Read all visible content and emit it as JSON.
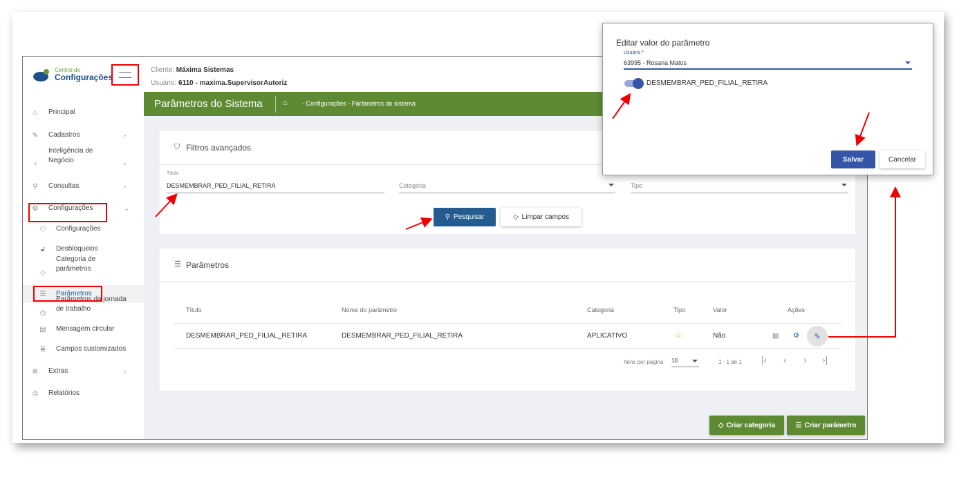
{
  "logo": {
    "line1": "Central de",
    "line2": "Configurações"
  },
  "header": {
    "client_label": "Cliente:",
    "client_value": "Máxima Sistemas",
    "user_label": "Usuário:",
    "user_value": "6110 - maxima.SupervisorAutoriz"
  },
  "sidebar": {
    "items": [
      {
        "label": "Principal",
        "icon": "home-icon"
      },
      {
        "label": "Cadastros",
        "icon": "edit-icon"
      },
      {
        "label": "Inteligência de Negócio",
        "icon": "bulb-icon"
      },
      {
        "label": "Consultas",
        "icon": "search-icon"
      },
      {
        "label": "Configurações",
        "icon": "gear-icon"
      },
      {
        "label": "Configurações",
        "icon": "group-icon"
      },
      {
        "label": "Desbloqueios",
        "icon": "lock-icon"
      },
      {
        "label": "Categoria de parâmetros",
        "icon": "tag-icon"
      },
      {
        "label": "Parâmetros",
        "icon": "list-icon"
      },
      {
        "label": "Parâmetros da jornada de trabalho",
        "icon": "clock-icon"
      },
      {
        "label": "Mensagem circular",
        "icon": "message-icon"
      },
      {
        "label": "Campos customizados",
        "icon": "fields-icon"
      },
      {
        "label": "Extras",
        "icon": "plus-circle-icon"
      },
      {
        "label": "Relatórios",
        "icon": "print-icon"
      }
    ]
  },
  "page": {
    "title": "Parâmetros do Sistema",
    "breadcrumb": "- Configurações - Parâmetros do sistema"
  },
  "filters": {
    "title": "Filtros avançados",
    "titulo_label": "Título",
    "titulo_value": "DESMEMBRAR_PED_FILIAL_RETIRA",
    "categoria_placeholder": "Categoria",
    "tipo_placeholder": "Tipo",
    "search_label": "Pesquisar",
    "clear_label": "Limpar campos"
  },
  "params": {
    "title": "Parâmetros",
    "columns": [
      "Título",
      "Nome do parâmetro",
      "Categoria",
      "Tipo",
      "Valor",
      "Ações"
    ],
    "rows": [
      {
        "titulo": "DESMEMBRAR_PED_FILIAL_RETIRA",
        "nome": "DESMEMBRAR_PED_FILIAL_RETIRA",
        "categoria": "APLICATIVO",
        "valor": "Não"
      }
    ],
    "items_per_page_label": "Itens por página",
    "items_per_page": "10",
    "range": "1 - 1 de 1"
  },
  "fab": {
    "create_category": "Criar categoria",
    "create_param": "Criar parâmetro"
  },
  "modal": {
    "title": "Editar valor do parâmetro",
    "user_label": "Usuário *",
    "user_value": "63995 - Rosana Matos",
    "toggle_label": "DESMEMBRAR_PED_FILIAL_RETIRA",
    "toggle_on": true,
    "save": "Salvar",
    "cancel": "Cancelar"
  },
  "colors": {
    "green": "#5e8a34",
    "blue": "#245c8f",
    "modal_blue": "#3556a8",
    "annotation": "#ee0000"
  }
}
